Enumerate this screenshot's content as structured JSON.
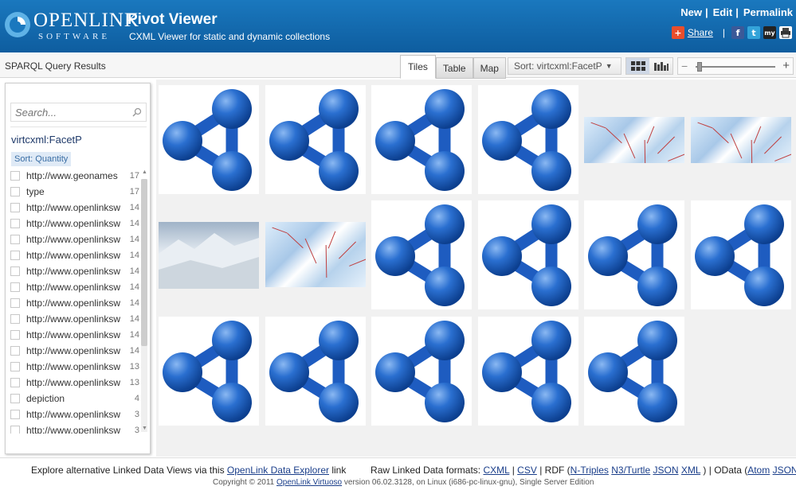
{
  "header": {
    "logo_word": "OPENLINK",
    "logo_sub": "SOFTWARE",
    "title": "Pivot Viewer",
    "subtitle": "CXML Viewer for static and dynamic collections",
    "links": [
      "New",
      "Edit",
      "Permalink"
    ],
    "link_sep": "|",
    "share_label": "Share",
    "share_icons": [
      "share-plus-icon",
      "facebook-icon",
      "twitter-icon",
      "myspace-icon",
      "print-icon"
    ],
    "share_icon_text": [
      "+",
      "f",
      "t",
      "my"
    ],
    "colors": {
      "header": "#1a78be",
      "facebook": "#3b5998",
      "twitter": "#33a3d9",
      "share": "#e94e2c"
    }
  },
  "toolbar": {
    "results_title": "SPARQL Query Results",
    "tabs": [
      "Tiles",
      "Table",
      "Map"
    ],
    "active_tab": "Tiles",
    "sort_label": "Sort: virtcxml:FacetP",
    "zoom_minus": "−",
    "zoom_plus": "+",
    "zoom_level": 0.02
  },
  "sidebar": {
    "search_placeholder": "Search...",
    "facet_name": "virtcxml:FacetP",
    "sort_tag": "Sort: Quantity",
    "facets": [
      {
        "label": "http://www.geonames",
        "count": "17"
      },
      {
        "label": "type",
        "count": "17"
      },
      {
        "label": "http://www.openlinksw",
        "count": "14"
      },
      {
        "label": "http://www.openlinksw",
        "count": "14"
      },
      {
        "label": "http://www.openlinksw",
        "count": "14"
      },
      {
        "label": "http://www.openlinksw",
        "count": "14"
      },
      {
        "label": "http://www.openlinksw",
        "count": "14"
      },
      {
        "label": "http://www.openlinksw",
        "count": "14"
      },
      {
        "label": "http://www.openlinksw",
        "count": "14"
      },
      {
        "label": "http://www.openlinksw",
        "count": "14"
      },
      {
        "label": "http://www.openlinksw",
        "count": "14"
      },
      {
        "label": "http://www.openlinksw",
        "count": "14"
      },
      {
        "label": "http://www.openlinksw",
        "count": "13"
      },
      {
        "label": "http://www.openlinksw",
        "count": "13"
      },
      {
        "label": "depiction",
        "count": "4"
      },
      {
        "label": "http://www.openlinksw",
        "count": "3"
      },
      {
        "label": "http://www.openlinksw",
        "count": "3"
      }
    ]
  },
  "grid": {
    "tiles": [
      "logo",
      "logo",
      "logo",
      "logo",
      "map",
      "map",
      "snow",
      "map",
      "logo",
      "logo",
      "logo",
      "logo",
      "logo",
      "logo",
      "logo",
      "logo",
      "logo"
    ]
  },
  "footer": {
    "explore_prefix": "Explore alternative Linked Data Views via this",
    "explore_link": "OpenLink Data Explorer",
    "explore_suffix": "link",
    "raw_prefix": "Raw Linked Data formats:",
    "cxml": "CXML",
    "csv": "CSV",
    "rdf_prefix": "| RDF (",
    "ntriples": "N-Triples",
    "n3": "N3/Turtle",
    "json": "JSON",
    "xml": "XML",
    "odata_prefix": ") | OData (",
    "atom": "Atom",
    "json2": "JSON",
    "close": ")",
    "copyright_prefix": "Copyright © 2011",
    "virtuoso_link": "OpenLink Virtuoso",
    "copyright_suffix": "version 06.02.3128, on Linux (i686-pc-linux-gnu), Single Server Edition"
  }
}
